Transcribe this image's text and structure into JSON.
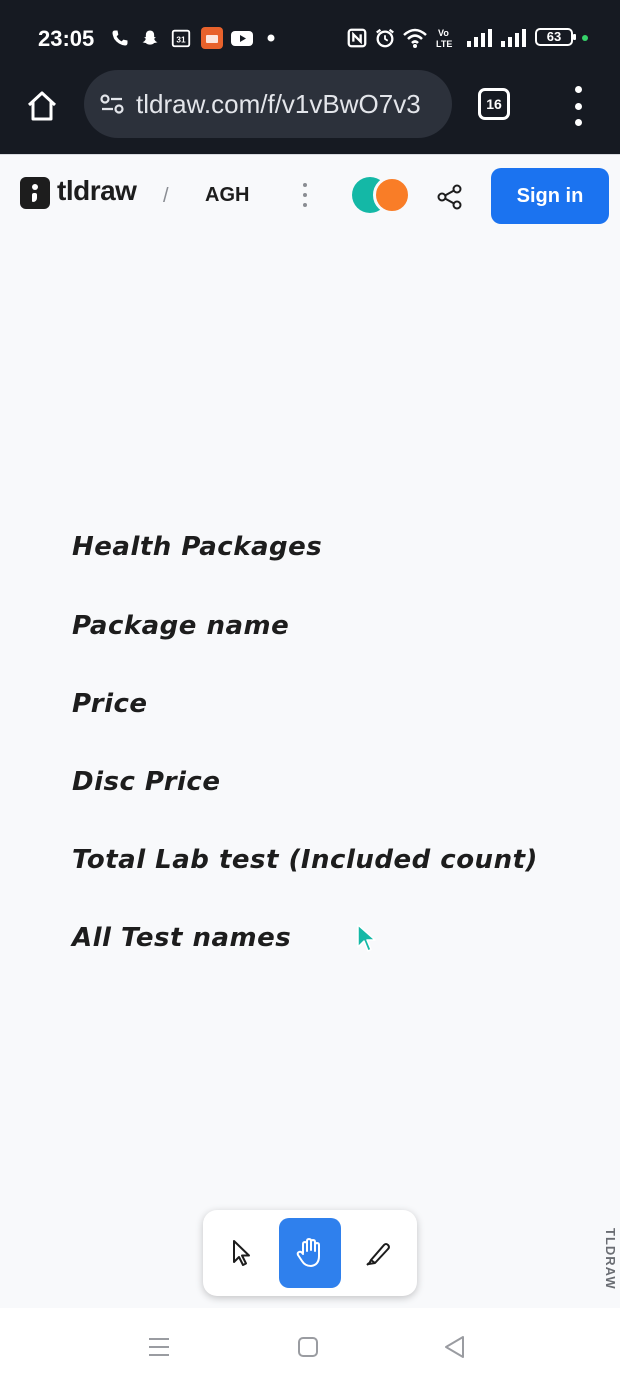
{
  "status_bar": {
    "time": "23:05",
    "battery": "63",
    "icons": [
      "phone-icon",
      "snapchat-icon",
      "calendar-icon",
      "app-icon",
      "youtube-icon",
      "dot-icon",
      "nfc-icon",
      "alarm-icon",
      "wifi-icon",
      "volte-icon",
      "signal-icon",
      "signal-icon"
    ]
  },
  "browser": {
    "url": "tldraw.com/f/v1vBwO7v3",
    "tab_count": "16"
  },
  "app_header": {
    "logo": "tldraw",
    "separator": "/",
    "file_name": "AGH",
    "sign_in_label": "Sign in",
    "avatar_colors": [
      "#14b8a6",
      "#f97d27"
    ]
  },
  "canvas": {
    "texts": [
      "Health Packages",
      "Package name",
      "Price",
      "Disc Price",
      "Total Lab test (Included count)",
      "All Test names"
    ]
  },
  "toolbar": {
    "tools": [
      "select-icon",
      "hand-icon",
      "draw-icon"
    ],
    "active_tool": "hand",
    "watermark": "TLDRAW"
  },
  "nav_bar": {
    "buttons": [
      "recents-icon",
      "home-icon",
      "back-icon"
    ]
  }
}
